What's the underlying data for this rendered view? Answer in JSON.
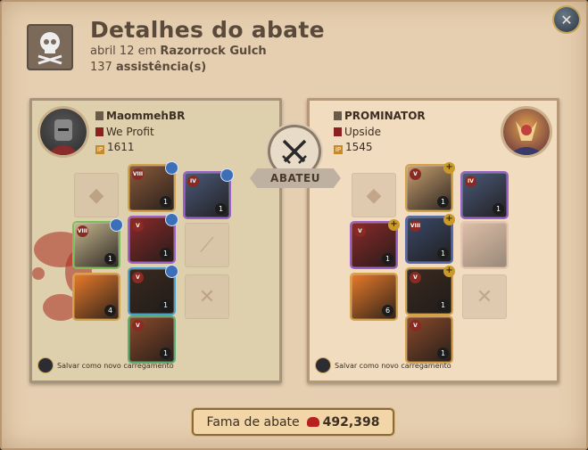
{
  "header": {
    "title": "Detalhes do abate",
    "date": "abril 12",
    "connector": "em",
    "location": "Razorrock Gulch",
    "assists_count": "137",
    "assists_label": "assistência(s)",
    "close_icon": "close-x-icon"
  },
  "killer": {
    "name": "MaommehBR",
    "guild": "We Profit",
    "ip": "1611",
    "save_label": "Salvar como novo carregamento",
    "slots": [
      {
        "name": "bag",
        "type": "empty",
        "tier": "",
        "qty": ""
      },
      {
        "name": "head",
        "type": "item",
        "tier": "VIII",
        "qty": "1",
        "color": "#8b5a3a",
        "rim": "#d4a24a",
        "badge": "star"
      },
      {
        "name": "cape",
        "type": "item",
        "tier": "IV",
        "qty": "1",
        "color": "#4a5a7a",
        "rim": "#9b63c9",
        "badge": "star"
      },
      {
        "name": "main-hand",
        "type": "item",
        "tier": "VIII",
        "qty": "1",
        "color": "#c8b890",
        "rim": "#7bbf5a",
        "badge": "star"
      },
      {
        "name": "armor",
        "type": "item",
        "tier": "V",
        "qty": "1",
        "color": "#8a2a2a",
        "rim": "#9b63c9",
        "badge": "star"
      },
      {
        "name": "off-hand",
        "type": "empty-weapon",
        "tier": "",
        "qty": ""
      },
      {
        "name": "potion",
        "type": "item",
        "tier": "",
        "qty": "4",
        "color": "#e87a2a",
        "rim": "#d4a24a",
        "badge": ""
      },
      {
        "name": "shoes",
        "type": "item",
        "tier": "V",
        "qty": "1",
        "color": "#3a2a20",
        "rim": "#4aa0d0",
        "badge": "star"
      },
      {
        "name": "food",
        "type": "empty",
        "tier": "",
        "qty": ""
      },
      {
        "name": "mount",
        "type": "item",
        "tier": "V",
        "qty": "1",
        "color": "#8a4a2a",
        "rim": "#5ab070",
        "badge": ""
      }
    ]
  },
  "victim": {
    "name": "PROMINATOR",
    "guild": "Upside",
    "ip": "1545",
    "save_label": "Salvar como novo carregamento",
    "slots": [
      {
        "name": "bag",
        "type": "empty",
        "tier": "",
        "qty": ""
      },
      {
        "name": "head",
        "type": "item",
        "tier": "V",
        "qty": "1",
        "color": "#c8a070",
        "rim": "#d4a24a",
        "badge": "plus"
      },
      {
        "name": "cape",
        "type": "item",
        "tier": "IV",
        "qty": "1",
        "color": "#4a5a7a",
        "rim": "#9b63c9",
        "badge": ""
      },
      {
        "name": "main-hand",
        "type": "item",
        "tier": "V",
        "qty": "1",
        "color": "#8a2a2a",
        "rim": "#9b63c9",
        "badge": "plus"
      },
      {
        "name": "armor",
        "type": "item",
        "tier": "VIII",
        "qty": "1",
        "color": "#3a4a6a",
        "rim": "#5a6ab0",
        "badge": "plus"
      },
      {
        "name": "off-hand",
        "type": "item-faded",
        "tier": "",
        "qty": "",
        "color": "#c89a8a",
        "rim": "#d8a8a0",
        "badge": ""
      },
      {
        "name": "potion",
        "type": "item",
        "tier": "",
        "qty": "6",
        "color": "#e87a2a",
        "rim": "#d4a24a",
        "badge": ""
      },
      {
        "name": "shoes",
        "type": "item",
        "tier": "V",
        "qty": "1",
        "color": "#3a2a20",
        "rim": "#d4a24a",
        "badge": "plus"
      },
      {
        "name": "food",
        "type": "empty",
        "tier": "",
        "qty": ""
      },
      {
        "name": "mount",
        "type": "item",
        "tier": "V",
        "qty": "1",
        "color": "#8a4a2a",
        "rim": "#d4a24a",
        "badge": ""
      }
    ]
  },
  "result_label": "ABATEU",
  "fame": {
    "label": "Fama de abate",
    "value": "492,398"
  }
}
